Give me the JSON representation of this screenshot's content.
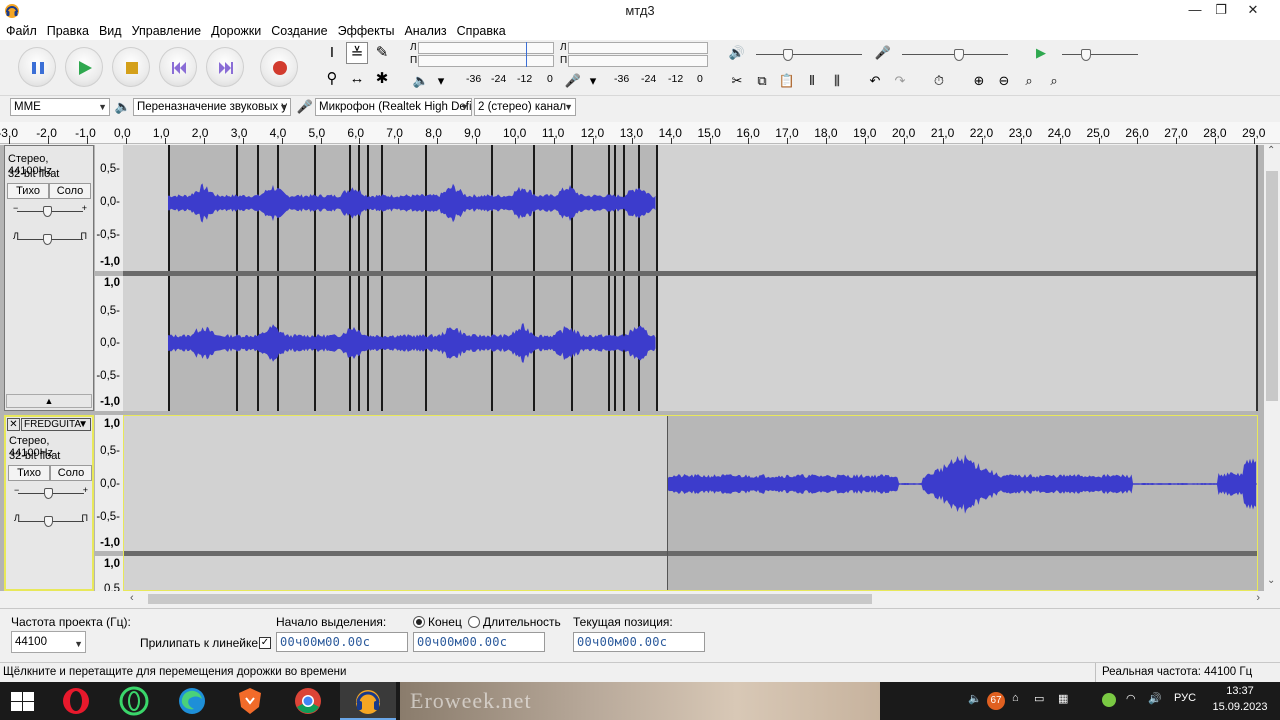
{
  "window": {
    "title": "мтд3",
    "minimize": "—",
    "maximize": "❐",
    "close": "✕"
  },
  "menu": [
    "Файл",
    "Правка",
    "Вид",
    "Управление",
    "Дорожки",
    "Создание",
    "Эффекты",
    "Анализ",
    "Справка"
  ],
  "meters": {
    "play_left": "Л",
    "play_right": "П",
    "ticks": [
      "-36",
      "-24",
      "-12",
      "0"
    ]
  },
  "devices": {
    "host": "MME",
    "output": "Переназначение звуковых у",
    "input": "Микрофон (Realtek High Defir",
    "channels": "2 (стерео) канал"
  },
  "ruler": {
    "labels": [
      "-3,0",
      "-2,0",
      "-1,0",
      "0,0",
      "1,0",
      "2,0",
      "3,0",
      "4,0",
      "5,0",
      "6,0",
      "7,0",
      "8,0",
      "9,0",
      "10,0",
      "11,0",
      "12,0",
      "13,0",
      "14,0",
      "15,0",
      "16,0",
      "17,0",
      "18,0",
      "19,0",
      "20,0",
      "21,0",
      "22,0",
      "23,0",
      "24,0",
      "25,0",
      "26,0",
      "27,0",
      "28,0",
      "29,0"
    ]
  },
  "track1": {
    "info_line1": "Стерео, 44100Hz",
    "info_line2": "32-bit float",
    "mute": "Тихо",
    "solo": "Соло",
    "gain_minus": "−",
    "gain_plus": "+",
    "pan_left": "Л",
    "pan_right": "П",
    "ch1_scale": [
      "0,5-",
      "0,0-",
      "-0,5-",
      "-1,0"
    ],
    "ch2_scale": [
      "1,0",
      "0,5-",
      "0,0-",
      "-0,5-",
      "-1,0"
    ]
  },
  "track2": {
    "name": "FREDGUITA",
    "info_line1": "Стерео, 44100Hz",
    "info_line2": "32-bit float",
    "mute": "Тихо",
    "solo": "Соло",
    "gain_minus": "−",
    "gain_plus": "+",
    "pan_left": "Л",
    "pan_right": "П",
    "ch1_scale": [
      "1,0",
      "0,5-",
      "0,0-",
      "-0,5-",
      "-1,0"
    ],
    "ch2_scale": [
      "1,0",
      "0,5"
    ]
  },
  "selection": {
    "rate_label": "Частота проекта (Гц):",
    "rate_value": "44100",
    "snap_label": "Прилипать к линейке",
    "snap_checked": true,
    "start_label": "Начало выделения:",
    "end_label": "Конец",
    "length_label": "Длительность",
    "end_selected": true,
    "position_label": "Текущая позиция:",
    "start_time": "00ч00м00.00с",
    "end_time": "00ч00м00.00с",
    "position_time": "00ч00м00.00с"
  },
  "status": {
    "hint": "Щёлкните и перетащите для перемещения дорожки во времени",
    "rate": "Реальная частота: 44100 Гц"
  },
  "taskbar": {
    "watermark": "Eroweek.net",
    "badge_count": "67",
    "language": "РУС",
    "time": "13:37",
    "date": "15.09.2023"
  },
  "colors": {
    "waveform": "#3c3ccc",
    "track_bg": "#d2d2d2",
    "clip_bg": "#b7b7b7",
    "selected_track_border": "#e8e85a"
  }
}
